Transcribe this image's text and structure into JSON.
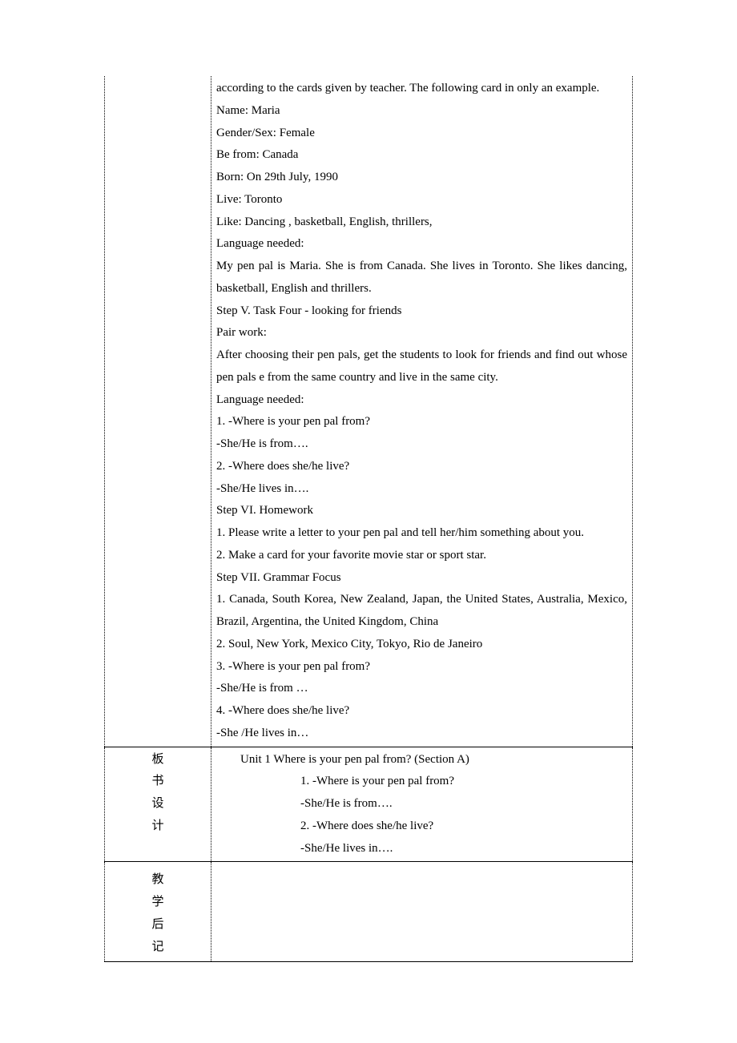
{
  "row1": {
    "content": [
      "according to the cards given by teacher. The following card in only an example.",
      "Name: Maria",
      "Gender/Sex: Female",
      "Be from: Canada",
      "Born: On 29th July, 1990",
      "Live: Toronto",
      "Like: Dancing , basketball, English, thrillers,",
      "Language needed:",
      "My pen pal is Maria. She is from Canada. She lives in Toronto. She likes dancing, basketball, English and thrillers.",
      "Step V.  Task Four - looking for friends",
      "Pair work:",
      "After choosing their pen pals, get the students to look for friends and find out whose pen pals e from the same country and live in the same city.",
      " Language needed:",
      "1. -Where is your pen pal from?",
      "  -She/He is from….",
      "2. -Where does she/he live?",
      "  -She/He lives in….",
      "Step VI. Homework",
      "1. Please write a letter to your pen pal and tell her/him something about you.",
      "2. Make a card for your favorite movie star or sport star.",
      "Step VII.  Grammar Focus",
      "1. Canada, South Korea, New Zealand, Japan, the United States, Australia, Mexico, Brazil, Argentina, the United Kingdom, China",
      "2. Soul, New York, Mexico City, Tokyo, Rio de Janeiro",
      "3. -Where is your pen pal from?",
      "  -She/He is from …",
      "4. -Where does she/he live?",
      "  -She /He lives in…"
    ]
  },
  "row2": {
    "label": [
      "板",
      "书",
      "设",
      "计"
    ],
    "lines": [
      "Unit 1 Where is your pen pal from? (Section A)",
      "1. -Where is your pen pal from?",
      "-She/He is from….",
      "2. -Where does she/he live?",
      "-She/He lives in…."
    ]
  },
  "row3": {
    "label": [
      "教",
      "学",
      "后",
      "记"
    ]
  }
}
